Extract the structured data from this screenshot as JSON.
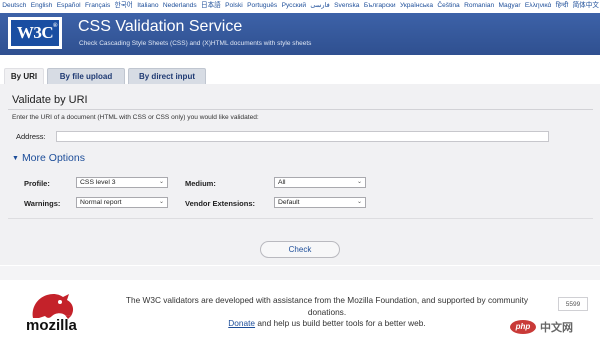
{
  "languages": [
    "Deutsch",
    "English",
    "Español",
    "Français",
    "한국어",
    "Italiano",
    "Nederlands",
    "日本語",
    "Polski",
    "Português",
    "Русский",
    "فارسی",
    "Svenska",
    "Български",
    "Українська",
    "Čeština",
    "Romanian",
    "Magyar",
    "Ελληνικά",
    "हिन्दी",
    "简体中文"
  ],
  "header": {
    "logo_text": "W3C",
    "title": "CSS Validation Service",
    "subtitle": "Check Cascading Style Sheets (CSS) and (X)HTML documents with style sheets"
  },
  "tabs": [
    {
      "label": "By URI",
      "active": true
    },
    {
      "label": "By file upload",
      "active": false
    },
    {
      "label": "By direct input",
      "active": false
    }
  ],
  "form": {
    "heading": "Validate by URI",
    "instructions": "Enter the URI of a document (HTML with CSS or CSS only) you would like validated:",
    "address_label": "Address:",
    "address_value": "",
    "more_options": "More Options",
    "profile_label": "Profile:",
    "profile_value": "CSS level 3",
    "medium_label": "Medium:",
    "medium_value": "All",
    "warnings_label": "Warnings:",
    "warnings_value": "Normal report",
    "vendor_label": "Vendor Extensions:",
    "vendor_value": "Default",
    "check_label": "Check"
  },
  "footer": {
    "mozilla_word": "mozilla",
    "line1": "The W3C validators are developed with assistance from the Mozilla Foundation, and supported by community donations.",
    "donate_link": "Donate",
    "line2_rest": " and help us build better tools for a better web.",
    "donation_count": "5599",
    "watermark_text": "php",
    "watermark_cn": "中文网"
  },
  "colors": {
    "header_bg": "#3a5c9e",
    "link": "#1c4d99",
    "panel_bg": "#f1f1f3",
    "mozilla_red": "#c4222a"
  }
}
